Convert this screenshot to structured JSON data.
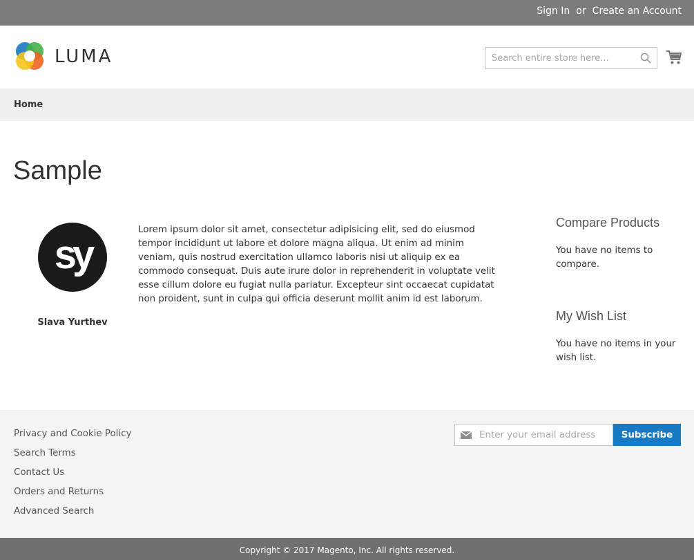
{
  "topbar": {
    "sign_in": "Sign In",
    "or": "or",
    "create_account": "Create an Account"
  },
  "header": {
    "logo_text": "LUMA",
    "search_placeholder": "Search entire store here...",
    "search_icon": "search-icon",
    "cart_icon": "cart-icon"
  },
  "breadcrumbs": [
    "Home"
  ],
  "main": {
    "title": "Sample",
    "author": {
      "avatar_initials": "sy",
      "name": "Slava Yurthev"
    },
    "body": "Lorem ipsum dolor sit amet, consectetur adipisicing elit, sed do eiusmod tempor incididunt ut labore et dolore magna aliqua. Ut enim ad minim veniam, quis nostrud exercitation ullamco laboris nisi ut aliquip ex ea commodo consequat. Duis aute irure dolor in reprehenderit in voluptate velit esse cillum dolore eu fugiat nulla pariatur. Excepteur sint occaecat cupidatat non proident, sunt in culpa qui officia deserunt mollit anim id est laborum."
  },
  "sidebar": {
    "compare": {
      "title": "Compare Products",
      "message": "You have no items to compare."
    },
    "wishlist": {
      "title": "My Wish List",
      "message": "You have no items in your wish list."
    }
  },
  "footer": {
    "links": [
      "Privacy and Cookie Policy",
      "Search Terms",
      "Contact Us",
      "Orders and Returns",
      "Advanced Search"
    ],
    "newsletter": {
      "placeholder": "Enter your email address",
      "subscribe_label": "Subscribe",
      "icon": "envelope-icon"
    },
    "copyright": "Copyright © 2017 Magento, Inc. All rights reserved."
  },
  "colors": {
    "topbar_bg": "#7b7c7b",
    "breadcrumb_bg": "#f0f0f0",
    "footer_bg": "#f4f4f4",
    "copyright_bg": "#6e716e",
    "accent": "#1979c3"
  }
}
